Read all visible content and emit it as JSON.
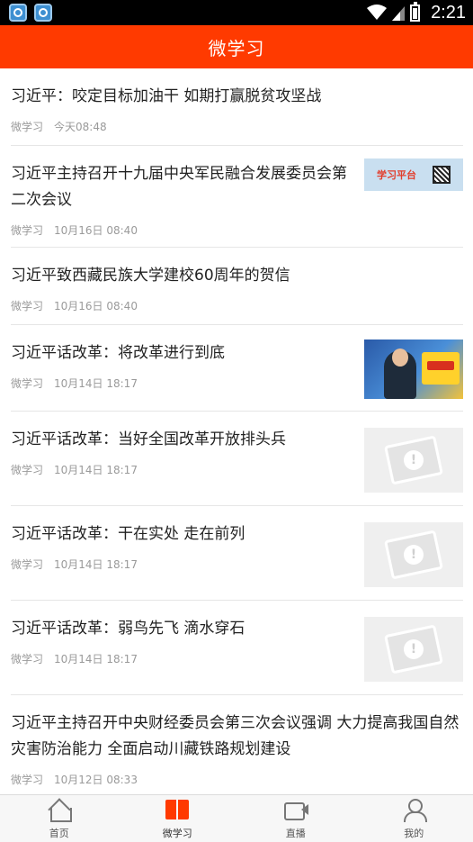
{
  "status_bar": {
    "time": "2:21"
  },
  "header": {
    "title": "微学习"
  },
  "articles": [
    {
      "title": "习近平：咬定目标加油干 如期打赢脱贫攻坚战",
      "source": "微学习",
      "time": "今天08:48"
    },
    {
      "title": "习近平主持召开十九届中央军民融合发展委员会第二次会议",
      "source": "微学习",
      "time": "10月16日 08:40",
      "thumb_text": "学习平台"
    },
    {
      "title": "习近平致西藏民族大学建校60周年的贺信",
      "source": "微学习",
      "time": "10月16日 08:40"
    },
    {
      "title": "习近平话改革：将改革进行到底",
      "source": "微学习",
      "time": "10月14日 18:17"
    },
    {
      "title": "习近平话改革：当好全国改革开放排头兵",
      "source": "微学习",
      "time": "10月14日 18:17"
    },
    {
      "title": "习近平话改革：干在实处 走在前列",
      "source": "微学习",
      "time": "10月14日 18:17"
    },
    {
      "title": "习近平话改革：弱鸟先飞 滴水穿石",
      "source": "微学习",
      "time": "10月14日 18:17"
    },
    {
      "title": "习近平主持召开中央财经委员会第三次会议强调 大力提高我国自然灾害防治能力 全面启动川藏铁路规划建设",
      "source": "微学习",
      "time": "10月12日 08:33"
    }
  ],
  "bottom_nav": [
    {
      "label": "首页",
      "icon": "home-icon"
    },
    {
      "label": "微学习",
      "icon": "book-icon"
    },
    {
      "label": "直播",
      "icon": "video-icon"
    },
    {
      "label": "我的",
      "icon": "user-icon"
    }
  ],
  "colors": {
    "accent": "#ff3a00"
  }
}
